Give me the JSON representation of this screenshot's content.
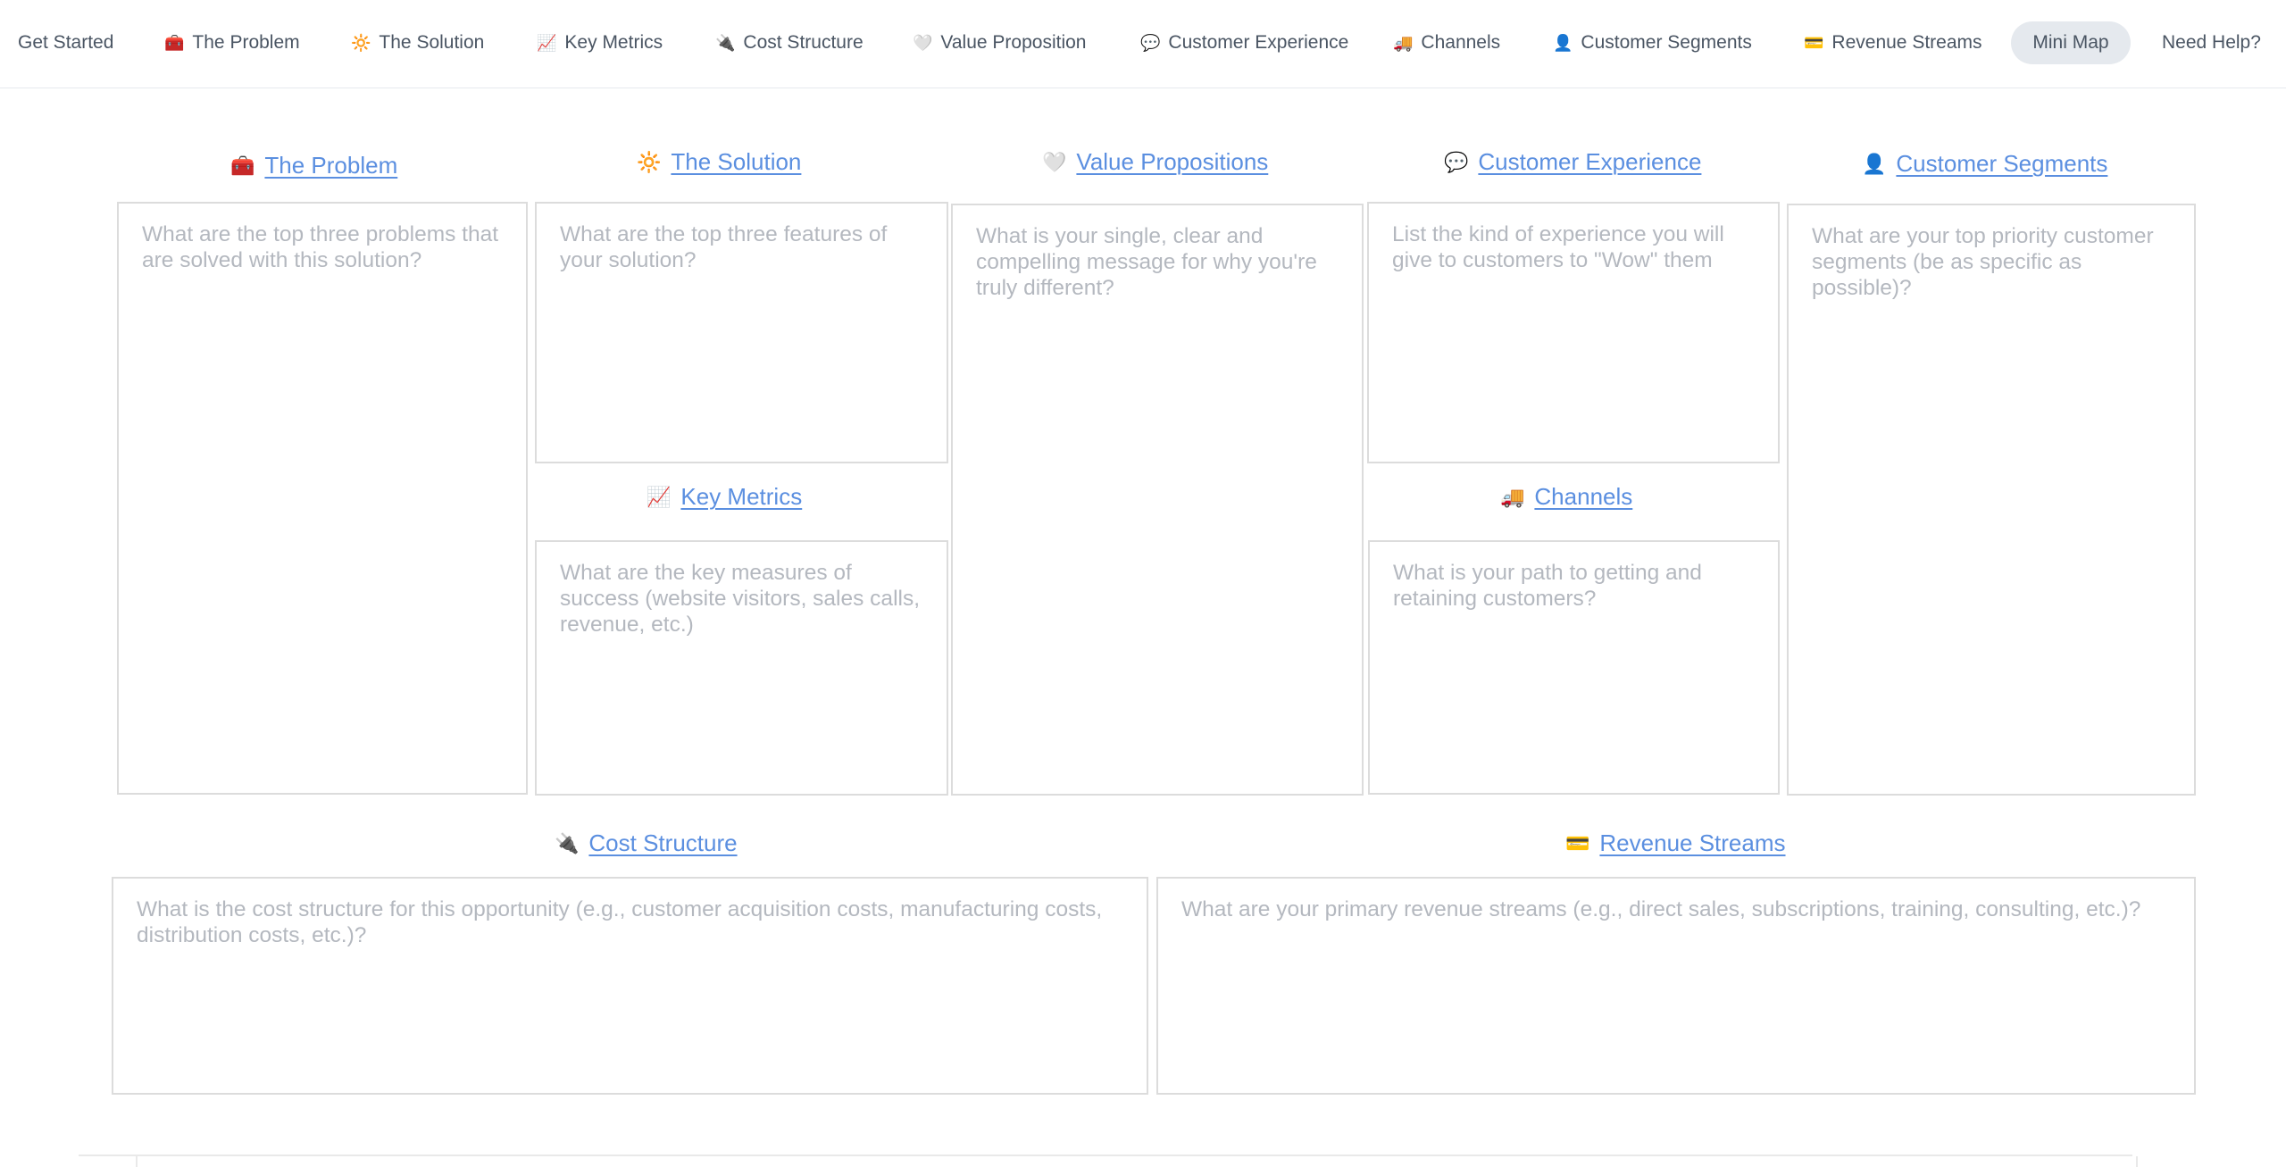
{
  "nav": {
    "get_started": "Get Started",
    "items": [
      {
        "label": "The Problem",
        "icon": "🧰"
      },
      {
        "label": "The Solution",
        "icon": "🔆"
      },
      {
        "label": "Key Metrics",
        "icon": "📈"
      },
      {
        "label": "Cost Structure",
        "icon": "🔌"
      },
      {
        "label": "Value Proposition",
        "icon": "🤍"
      },
      {
        "label": "Customer Experience",
        "icon": "💬"
      },
      {
        "label": "Channels",
        "icon": "🚚"
      },
      {
        "label": "Customer Segments",
        "icon": "👤"
      },
      {
        "label": "Revenue Streams",
        "icon": "💳"
      }
    ],
    "mini_map": "Mini Map",
    "need_help": "Need Help?"
  },
  "sections": {
    "problem": {
      "title": "The Problem",
      "icon": "🧰",
      "placeholder": "What are the top three problems that are solved with this solution?"
    },
    "solution": {
      "title": "The Solution",
      "icon": "🔆",
      "placeholder": "What are the top three features of your solution?"
    },
    "value": {
      "title": "Value Propositions",
      "icon": "🤍",
      "placeholder": "What is your single, clear and compelling message for why you're truly different?"
    },
    "experience": {
      "title": "Customer Experience",
      "icon": "💬",
      "placeholder": "List the kind of experience you will give to customers to \"Wow\" them"
    },
    "segments": {
      "title": "Customer Segments",
      "icon": "👤",
      "placeholder": "What are your top priority customer segments (be as specific as possible)?"
    },
    "metrics": {
      "title": "Key Metrics",
      "icon": "📈",
      "placeholder": "What are the key measures of success (website visitors, sales calls, revenue, etc.)"
    },
    "channels": {
      "title": "Channels",
      "icon": "🚚",
      "placeholder": "What is your path to getting and retaining customers?"
    },
    "cost": {
      "title": "Cost Structure",
      "icon": "🔌",
      "placeholder": "What is the cost structure for this opportunity (e.g., customer acquisition costs, manufacturing costs, distribution costs, etc.)?"
    },
    "revenue": {
      "title": "Revenue Streams",
      "icon": "💳",
      "placeholder": "What are your primary revenue streams (e.g., direct sales, subscriptions, training, consulting, etc.)?"
    }
  },
  "colors": {
    "link": "#5b8fe0",
    "placeholder": "#b4b8bf",
    "border": "#dcdcdc",
    "pill": "#e5e9ee"
  }
}
